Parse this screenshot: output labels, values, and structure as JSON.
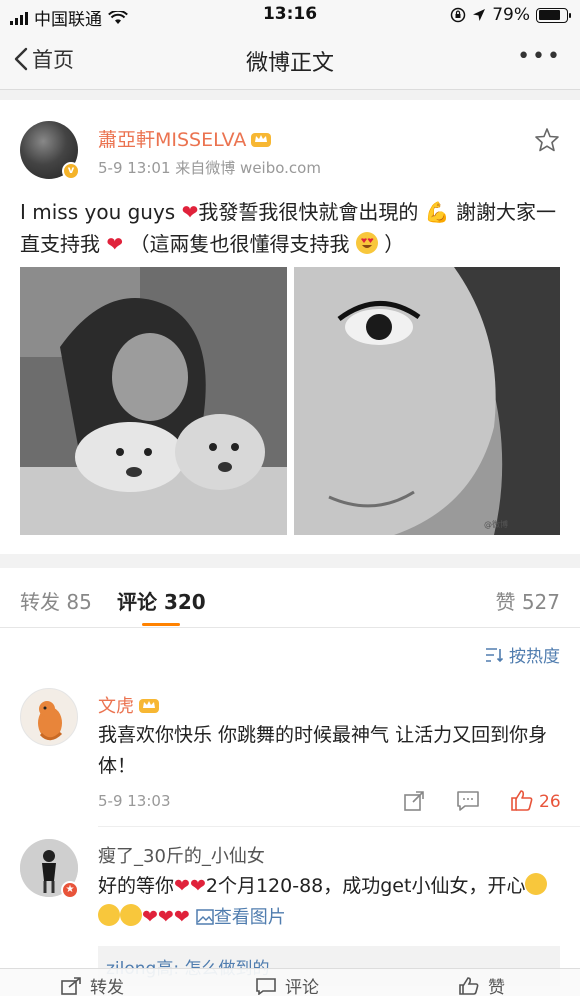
{
  "status_bar": {
    "carrier": "中国联通",
    "time": "13:16",
    "battery": "79%",
    "battery_level": 0.79
  },
  "nav": {
    "back_label": "首页",
    "title": "微博正文"
  },
  "post": {
    "author": "蕭亞軒MISSELVA",
    "time": "5-9 13:01",
    "source": "来自微博 weibo.com",
    "text_a": "I miss you guys ",
    "text_b": "我發誓我很快就會出現的 ",
    "text_c": " 謝謝大家一直支持我 ",
    "text_d": " （這兩隻也很懂得支持我 ",
    "text_e": " ）",
    "watermark": "@微博"
  },
  "tabs": {
    "repost": "转发 85",
    "comment": "评论 320",
    "like": "赞 527"
  },
  "sort_label": "按热度",
  "comments": [
    {
      "name": "文虎",
      "text": "我喜欢你快乐 你跳舞的时候最神气 让活力又回到你身体！",
      "time": "5-9 13:03",
      "likes": "26"
    },
    {
      "name": "瘦了_30斤的_小仙女",
      "text_a": "好的等你",
      "text_b": "2个月120-88，成功get小仙女，开心",
      "image_link": "查看图片",
      "subreply": "zilong高: 怎么做到的"
    }
  ],
  "bottom_bar": {
    "repost": "转发",
    "comment": "评论",
    "like": "赞"
  },
  "colors": {
    "accent": "#ff8200",
    "name": "#eb7350",
    "link": "#507daf",
    "like": "#e8543a",
    "heart": "#e0223b"
  },
  "icons": [
    "wifi-icon",
    "lock-rotation-icon",
    "location-icon",
    "back-chevron-icon",
    "more-icon",
    "star-icon",
    "sort-icon",
    "share-icon",
    "comment-icon",
    "thumbs-up-icon",
    "crown-icon",
    "image-icon"
  ]
}
